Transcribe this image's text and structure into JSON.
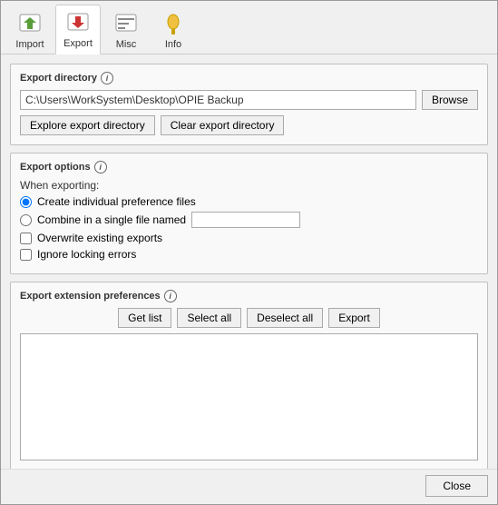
{
  "toolbar": {
    "items": [
      {
        "id": "import",
        "label": "Import",
        "icon": "↩",
        "active": false
      },
      {
        "id": "export",
        "label": "Export",
        "icon": "↪",
        "active": true
      },
      {
        "id": "misc",
        "label": "Misc",
        "icon": "⚙",
        "active": false
      },
      {
        "id": "info",
        "label": "Info",
        "icon": "💡",
        "active": false
      }
    ]
  },
  "export_directory": {
    "section_title": "Export directory",
    "info_icon": "i",
    "path_value": "C:\\Users\\WorkSystem\\Desktop\\OPIE Backup",
    "browse_label": "Browse",
    "explore_label": "Explore export directory",
    "clear_label": "Clear export directory"
  },
  "export_options": {
    "section_title": "Export options",
    "info_icon": "i",
    "when_label": "When exporting:",
    "radio1_label": "Create individual preference files",
    "radio2_label": "Combine in a single file named",
    "combine_placeholder": "",
    "check1_label": "Overwrite existing exports",
    "check2_label": "Ignore locking errors"
  },
  "export_extension": {
    "section_title": "Export extension preferences",
    "info_icon": "i",
    "get_list_label": "Get list",
    "select_all_label": "Select all",
    "deselect_all_label": "Deselect all",
    "export_label": "Export"
  },
  "footer": {
    "close_label": "Close"
  }
}
